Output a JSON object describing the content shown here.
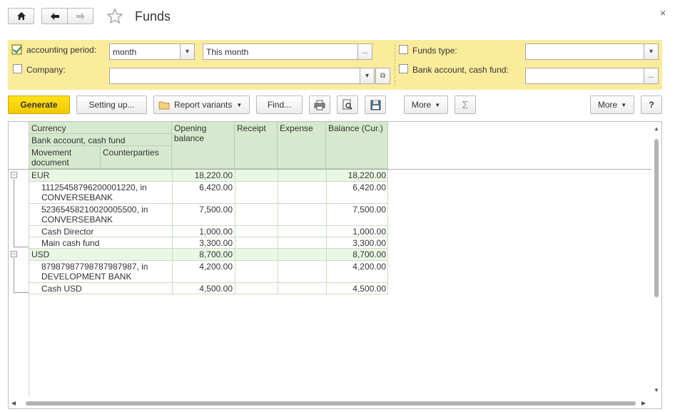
{
  "window": {
    "title": "Funds",
    "close_glyph": "×"
  },
  "nav": {
    "home_icon": "home-icon",
    "back_icon": "arrow-left-icon",
    "forward_icon": "arrow-right-icon",
    "favorite_icon": "star-icon"
  },
  "filters": {
    "accounting_period": {
      "label": "accounting period:",
      "checked": true,
      "period_type": "month",
      "period_value": "This month"
    },
    "company": {
      "label": "Company:",
      "checked": false,
      "value": ""
    },
    "funds_type": {
      "label": "Funds type:",
      "checked": false,
      "value": ""
    },
    "bank_account": {
      "label": "Bank account, cash fund:",
      "checked": false,
      "value": ""
    },
    "dropdown_glyph": "▾",
    "ellipsis_glyph": "...",
    "open_glyph": "⧉"
  },
  "toolbar": {
    "generate": "Generate",
    "setting_up": "Setting up...",
    "report_variants": "Report variants",
    "find": "Find...",
    "more1": "More",
    "more2": "More",
    "help": "?",
    "sigma": "Σ"
  },
  "table": {
    "headers": {
      "currency": "Currency",
      "bank_account": "Bank account, cash fund",
      "movement_document": "Movement document",
      "counterparties": "Counterparties",
      "opening_balance": "Opening balance",
      "receipt": "Receipt",
      "expense": "Expense",
      "balance_cur": "Balance (Cur.)"
    },
    "groups": [
      {
        "name": "EUR",
        "opening": "18,220.00",
        "receipt": "",
        "expense": "",
        "balance": "18,220.00",
        "rows": [
          {
            "name": "11125458796200001220, in CONVERSEBANK",
            "opening": "6,420.00",
            "balance": "6,420.00"
          },
          {
            "name": "52365458210020005500, in CONVERSEBANK",
            "opening": "7,500.00",
            "balance": "7,500.00"
          },
          {
            "name": "Cash Director",
            "opening": "1,000.00",
            "balance": "1,000.00"
          },
          {
            "name": "Main cash fund",
            "opening": "3,300.00",
            "balance": "3,300.00"
          }
        ]
      },
      {
        "name": "USD",
        "opening": "8,700.00",
        "receipt": "",
        "expense": "",
        "balance": "8,700.00",
        "rows": [
          {
            "name": "87987987798787987987, in DEVELOPMENT BANK",
            "opening": "4,200.00",
            "balance": "4,200.00"
          },
          {
            "name": "Cash USD",
            "opening": "4,500.00",
            "balance": "4,500.00"
          }
        ]
      }
    ],
    "collapse_glyph": "−"
  },
  "colors": {
    "panel_bg": "#fbec9c",
    "generate_bg": "#f5d000",
    "header_bg": "#d6e8cd",
    "group_bg": "#ebf7e5"
  }
}
